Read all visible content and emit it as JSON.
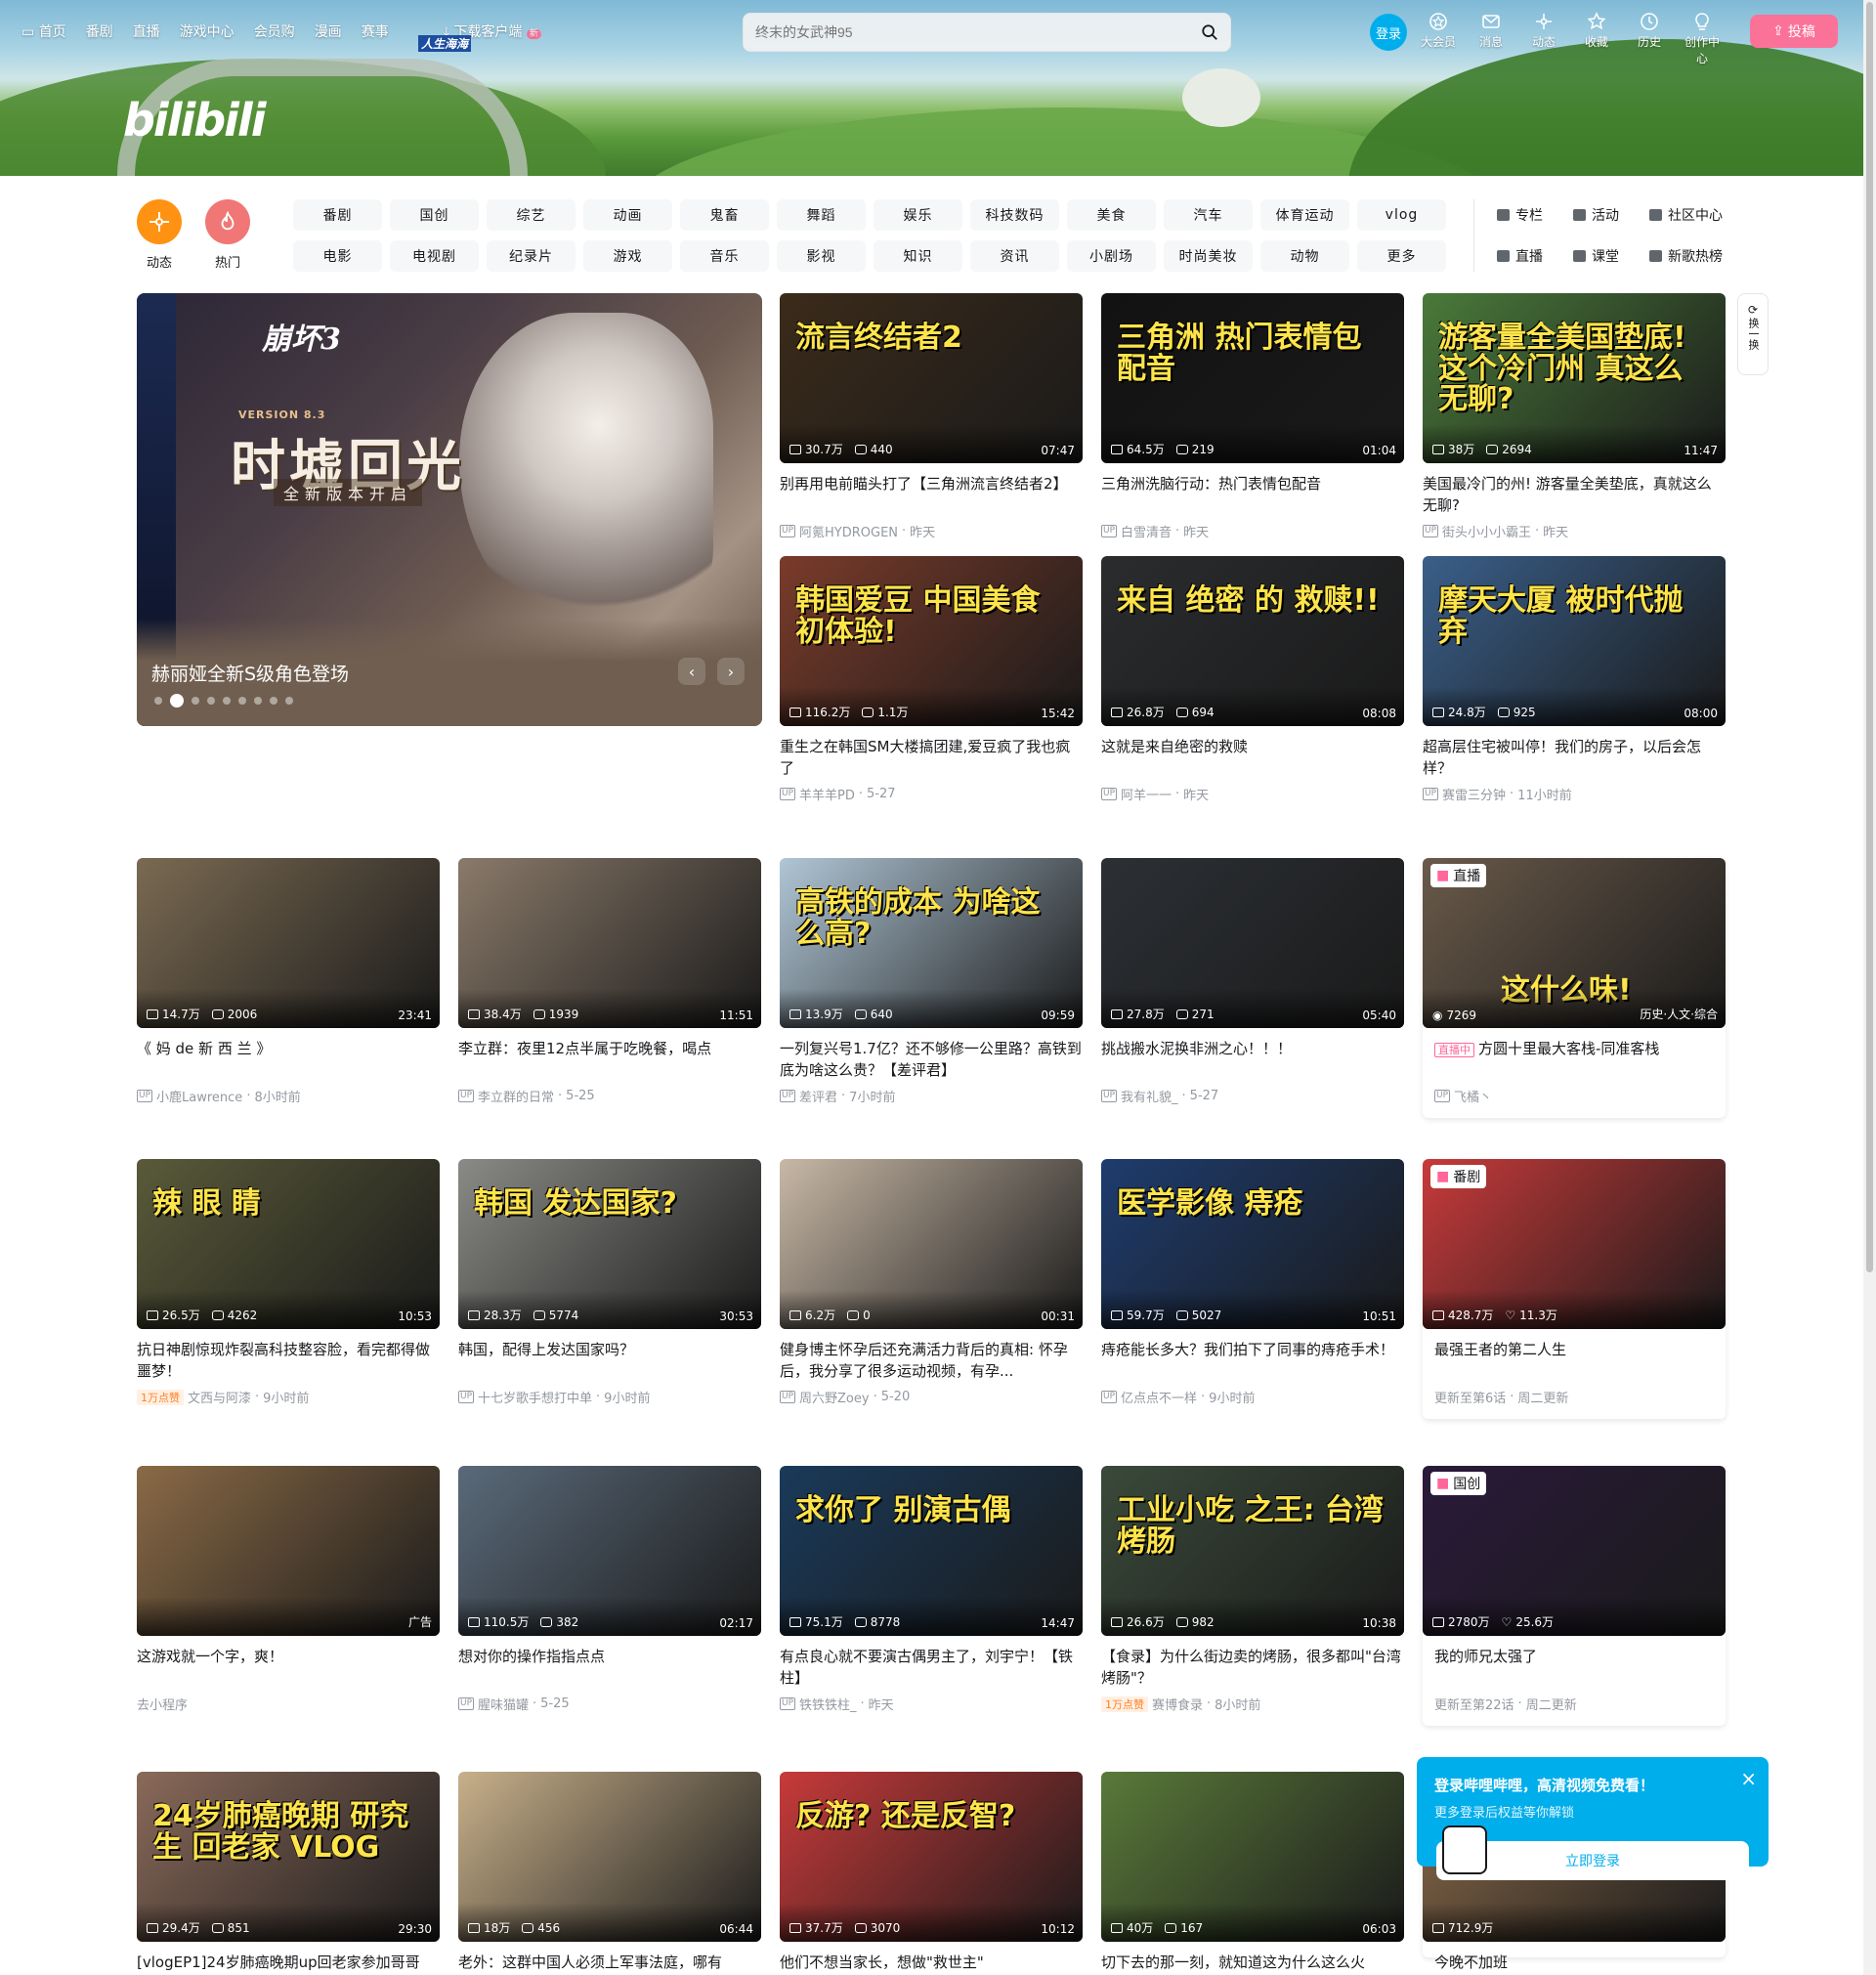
{
  "nav": {
    "items": [
      "首页",
      "番剧",
      "直播",
      "游戏中心",
      "会员购",
      "漫画",
      "赛事"
    ],
    "special_badge": "人生海海",
    "download": "下载客户端",
    "new_badge": "新"
  },
  "logo_text": "bilibili",
  "search": {
    "placeholder": "终末的女武神95"
  },
  "header_right": {
    "login": "登录",
    "items": [
      "大会员",
      "消息",
      "动态",
      "收藏",
      "历史",
      "创作中心"
    ],
    "upload": "投稿"
  },
  "quick": {
    "dynamic": "动态",
    "hot": "热门"
  },
  "channels": [
    "番剧",
    "国创",
    "综艺",
    "动画",
    "鬼畜",
    "舞蹈",
    "娱乐",
    "科技数码",
    "美食",
    "汽车",
    "体育运动",
    "vlog",
    "电影",
    "电视剧",
    "纪录片",
    "游戏",
    "音乐",
    "影视",
    "知识",
    "资讯",
    "小剧场",
    "时尚美妆",
    "动物",
    "更多"
  ],
  "extras": [
    "专栏",
    "活动",
    "社区中心",
    "直播",
    "课堂",
    "新歌热榜"
  ],
  "carousel": {
    "game_logo": "崩坏3",
    "version": "VERSION 8.3",
    "headline": "时墟回光",
    "sub": "全新版本开启",
    "title": "赫丽娅全新S级角色登场",
    "dot_count": 9,
    "active_dot": 1
  },
  "refresh": {
    "label": "换一换"
  },
  "cards": [
    {
      "plays": "30.7万",
      "danmaku": "440",
      "duration": "07:47",
      "title": "别再用电前瞄头打了【三角洲流言终结者2】",
      "author": "阿氪HYDROGEN",
      "date": "昨天",
      "art": "流言终结者2",
      "bg": "#3b2b1a"
    },
    {
      "plays": "64.5万",
      "danmaku": "219",
      "duration": "01:04",
      "title": "三角洲洗脑行动：热门表情包配音",
      "author": "白雪清音",
      "date": "昨天",
      "art": "三角洲 热门表情包配音",
      "bg": "#121212"
    },
    {
      "plays": "38万",
      "danmaku": "2694",
      "duration": "11:47",
      "title": "美国最冷门的州! 游客量全美垫底，真就这么无聊?",
      "author": "街头小小小霸王",
      "date": "昨天",
      "art": "游客量全美国垫底! 这个冷门州 真这么无聊?",
      "bg": "#4a7a3a"
    },
    {
      "plays": "116.2万",
      "danmaku": "1.1万",
      "duration": "15:42",
      "title": "重生之在韩国SM大楼搞团建,爱豆疯了我也疯了",
      "author": "羊羊羊PD",
      "date": "5-27",
      "art": "韩国爱豆 中国美食 初体验!",
      "bg": "#7a3b2a"
    },
    {
      "plays": "26.8万",
      "danmaku": "694",
      "duration": "08:08",
      "title": "这就是来自绝密的救赎",
      "author": "阿羊一一",
      "date": "昨天",
      "art": "来自 绝密 的 救赎!!",
      "bg": "#2a2c2e"
    },
    {
      "plays": "24.8万",
      "danmaku": "925",
      "duration": "08:00",
      "title": "超高层住宅被叫停！我们的房子，以后会怎样？",
      "author": "赛雷三分钟",
      "date": "11小时前",
      "art": "摩天大厦 被时代抛弃",
      "bg": "#3a5f8a"
    },
    {
      "plays": "14.7万",
      "danmaku": "2006",
      "duration": "23:41",
      "title": "《 妈 de 新 西 兰 》",
      "author": "小鹿Lawrence",
      "date": "8小时前",
      "art": "",
      "bg": "#7a6a52"
    },
    {
      "plays": "38.4万",
      "danmaku": "1939",
      "duration": "11:51",
      "title": "李立群：夜里12点半属于吃晚餐，喝点",
      "author": "李立群的日常",
      "date": "5-25",
      "art": "",
      "bg": "#8a7a6a"
    },
    {
      "plays": "13.9万",
      "danmaku": "640",
      "duration": "09:59",
      "title": "一列复兴号1.7亿？还不够修一公里路？高铁到底为啥这么贵？【差评君】",
      "author": "差评君",
      "date": "7小时前",
      "art": "高铁的成本 为啥这么高?",
      "bg": "#b0c6d6"
    },
    {
      "plays": "27.8万",
      "danmaku": "271",
      "duration": "05:40",
      "title": "挑战搬水泥换非洲之心！！！",
      "author": "我有礼貌_",
      "date": "5-27",
      "art": "",
      "bg": "#2c3035"
    },
    {
      "plays": "26.5万",
      "danmaku": "4262",
      "duration": "10:53",
      "title": "抗日神剧惊现炸裂高科技整容脸，看完都得做噩梦！",
      "author": "文西与阿漆",
      "date": "9小时前",
      "like": "1万点赞",
      "art": "辣 眼 睛",
      "bg": "#5a5a3a"
    },
    {
      "plays": "28.3万",
      "danmaku": "5774",
      "duration": "30:53",
      "title": "韩国，配得上发达国家吗？",
      "author": "十七岁歌手想打中单",
      "date": "9小时前",
      "art": "韩国 发达国家?",
      "bg": "#8a8a86"
    },
    {
      "plays": "6.2万",
      "danmaku": "0",
      "duration": "00:31",
      "title": "健身博主怀孕后还充满活力背后的真相: 怀孕后，我分享了很多运动视频，有孕...",
      "author": "周六野Zoey",
      "date": "5-20",
      "art": "",
      "bg": "#c8b8a6"
    },
    {
      "plays": "59.7万",
      "danmaku": "5027",
      "duration": "10:51",
      "title": "痔疮能长多大？我们拍下了同事的痔疮手术！",
      "author": "亿点点不一样",
      "date": "9小时前",
      "art": "医学影像 痔疮",
      "bg": "#1e3c6e"
    },
    {
      "plays": "",
      "danmaku": "",
      "duration": "",
      "title": "这游戏就一个字，爽！",
      "author": "去小程序",
      "date": "",
      "ad": "广告",
      "art": "",
      "bg": "#8a6a46"
    },
    {
      "plays": "110.5万",
      "danmaku": "382",
      "duration": "02:17",
      "title": "想对你的操作指指点点",
      "author": "腥味猫罐",
      "date": "5-25",
      "art": "",
      "bg": "#5a6a7a"
    },
    {
      "plays": "75.1万",
      "danmaku": "8778",
      "duration": "14:47",
      "title": "有点良心就不要演古偶男主了，刘宇宁！【铁柱】",
      "author": "铁铁铁柱_",
      "date": "昨天",
      "art": "求你了 别演古偶",
      "bg": "#1a3a5a"
    },
    {
      "plays": "26.6万",
      "danmaku": "982",
      "duration": "10:38",
      "title": "【食录】为什么街边卖的烤肠，很多都叫\"台湾烤肠\"？",
      "author": "赛博食录",
      "date": "8小时前",
      "like": "1万点赞",
      "art": "工业小吃 之王: 台湾烤肠",
      "bg": "#3a4a3a"
    },
    {
      "plays": "29.4万",
      "danmaku": "851",
      "duration": "29:30",
      "title": "[vlogEP1]24岁肺癌晚期up回老家参加哥哥",
      "author": "",
      "date": "",
      "art": "24岁肺癌晚期 研究生 回老家 VLOG",
      "bg": "#8a6a5a"
    },
    {
      "plays": "18万",
      "danmaku": "456",
      "duration": "06:44",
      "title": "老外：这群中国人必须上军事法庭，哪有",
      "author": "",
      "date": "",
      "art": "",
      "bg": "#c8b08a"
    },
    {
      "plays": "37.7万",
      "danmaku": "3070",
      "duration": "10:12",
      "title": "他们不想当家长，想做\"救世主\"",
      "author": "",
      "date": "",
      "art": "反游? 还是反智?",
      "bg": "#c83a3a"
    },
    {
      "plays": "40万",
      "danmaku": "167",
      "duration": "06:03",
      "title": "切下去的那一刻，就知道这为什么这么火",
      "author": "",
      "date": "",
      "art": "",
      "bg": "#5a7a3a"
    }
  ],
  "specials": [
    {
      "badge": "直播",
      "viewers": "7269",
      "area": "历史·人文·综合",
      "live_tag": "直播中",
      "title": "方圆十里最大客栈-同准客栈",
      "author": "飞橘丶",
      "art": "这什么味!",
      "bg": "#6a5a4a"
    },
    {
      "badge": "番剧",
      "plays": "428.7万",
      "likes": "11.3万",
      "title": "最强王者的第二人生",
      "update": "更新至第6话",
      "day": "周二更新",
      "bg": "#c83a3a"
    },
    {
      "badge": "国创",
      "plays": "2780万",
      "likes": "25.6万",
      "title": "我的师兄太强了",
      "update": "更新至第22话",
      "day": "周二更新",
      "bg": "#2a1a3a"
    },
    {
      "plays": "712.9万",
      "title": "今晚不加班",
      "bg": "#8a6a4a"
    }
  ],
  "popup": {
    "title": "登录哔哩哔哩，高清视频免费看！",
    "subtitle": "更多登录后权益等你解锁",
    "button": "立即登录"
  }
}
